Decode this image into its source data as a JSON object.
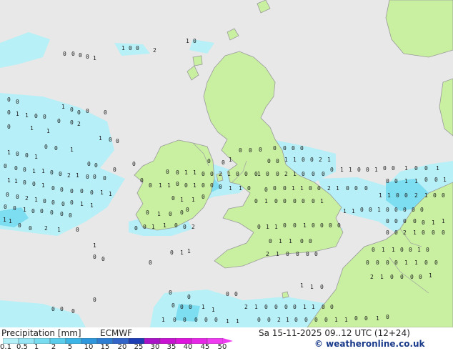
{
  "map": {
    "sea_color": "#e8e8e8",
    "land_color": "#c8f0a0",
    "coast_color": "#9a9a9a"
  },
  "footer": {
    "title": "Precipitation [mm]",
    "model": "ECMWF",
    "datetime": "Sa 15-11-2025 09..12 UTC (12+24)",
    "copyright": "© weatheronline.co.uk"
  },
  "legend": {
    "ticks": [
      "0.1",
      "0.5",
      "1",
      "2",
      "5",
      "10",
      "15",
      "20",
      "25",
      "30",
      "35",
      "40",
      "45",
      "50"
    ],
    "colors": [
      "#b4f0f8",
      "#96e6f5",
      "#78dcf0",
      "#5acdec",
      "#3cb4e6",
      "#2d96dc",
      "#2d7dd2",
      "#3264c8",
      "#1e3cb4",
      "#aa14c8",
      "#c814d2",
      "#dc14dc",
      "#e628e6",
      "#f03cf0"
    ]
  },
  "points": {
    "values": [
      "0",
      "0",
      "0",
      "0",
      "1",
      "1",
      "0",
      "0",
      "2",
      "1",
      "0",
      "0",
      "0",
      "0",
      "1",
      "1",
      "0",
      "0",
      "1",
      "0"
    ]
  }
}
